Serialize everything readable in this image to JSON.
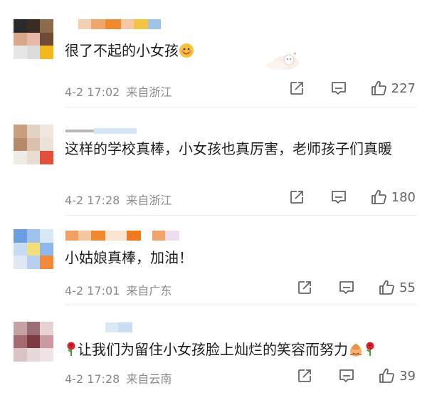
{
  "comments": [
    {
      "text": "很了不起的小女孩",
      "time": "4-2 17:02",
      "location": "来自浙江",
      "likes": "227"
    },
    {
      "text": "这样的学校真棒，小女孩也真厉害，老师孩子们真暖",
      "time": "4-2 17:28",
      "location": "来自浙江",
      "likes": "180"
    },
    {
      "text": "小姑娘真棒，加油！",
      "time": "4-2 17:01",
      "location": "来自广东",
      "likes": "55"
    },
    {
      "text": "让我们为留住小女孩脸上灿烂的笑容而努力",
      "time": "4-2 17:28",
      "location": "来自云南",
      "likes": "39"
    }
  ],
  "icons": {
    "share": "share-icon",
    "reply": "comment-icon",
    "like": "thumbs-up-icon",
    "emoji": "smiling-face-emoji",
    "rose": "rose-emoji",
    "hands": "praying-hands-emoji"
  },
  "colors": {
    "meta_text": "#8a8a8a",
    "icon": "#666666"
  }
}
